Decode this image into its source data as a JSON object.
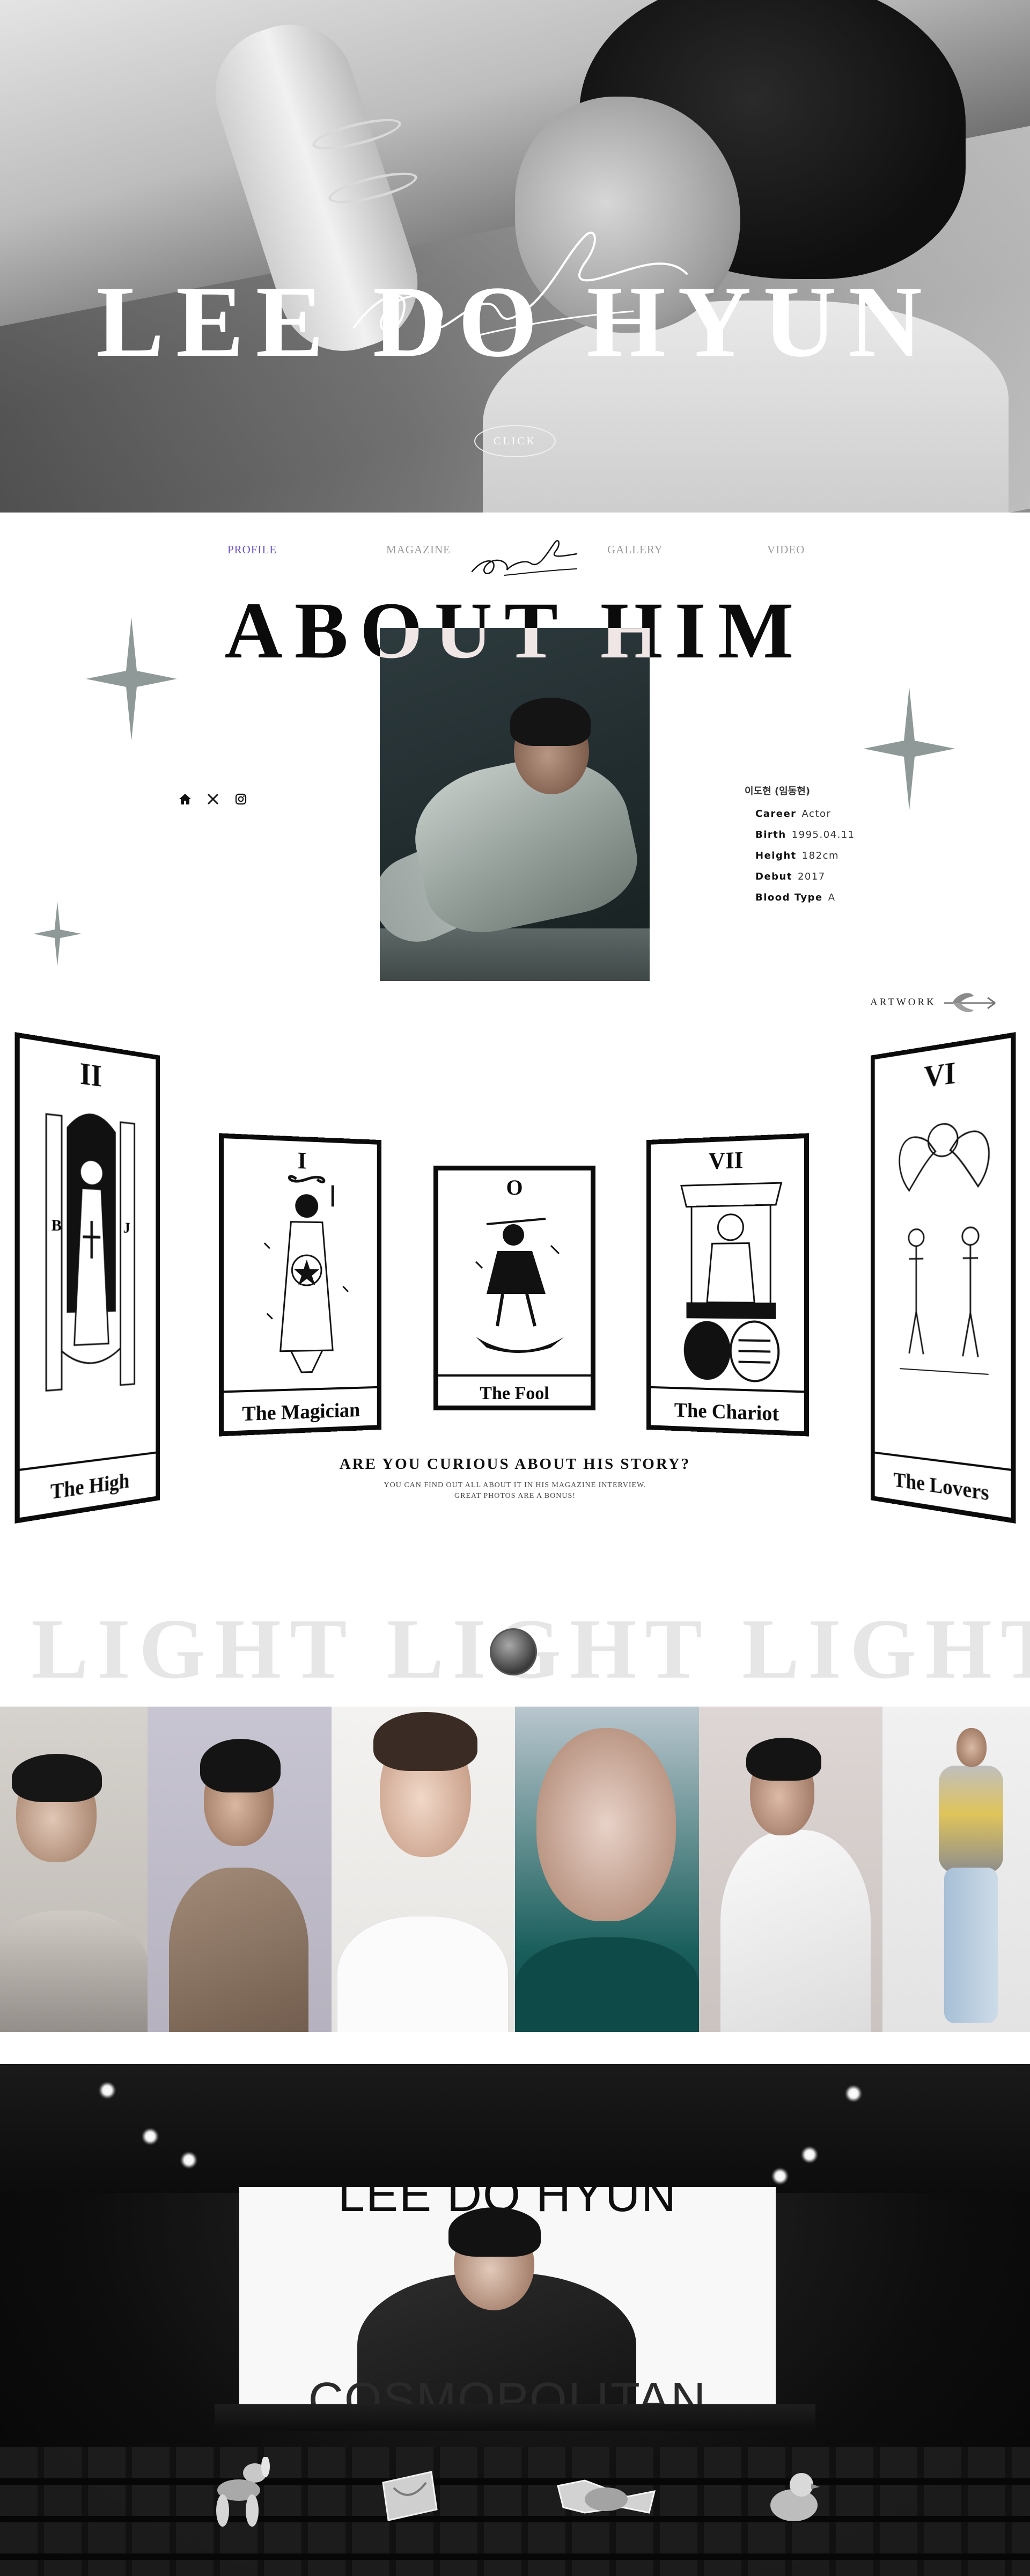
{
  "hero": {
    "title": "LEE DO HYUN",
    "button_label": "CLICK"
  },
  "nav": {
    "items": [
      {
        "label": "PROFILE",
        "active": true
      },
      {
        "label": "MAGAZINE",
        "active": false
      },
      {
        "label": "GALLERY",
        "active": false
      },
      {
        "label": "VIDEO",
        "active": false
      }
    ],
    "active_color": "#6a4fc8"
  },
  "about": {
    "title": "ABOUT HIM",
    "social_icons": [
      "home-icon",
      "x-icon",
      "instagram-icon"
    ],
    "profile": {
      "name": "이도현 (임동현)",
      "rows": [
        {
          "key": "Career",
          "value": "Actor"
        },
        {
          "key": "Birth",
          "value": "1995.04.11"
        },
        {
          "key": "Height",
          "value": "182cm"
        },
        {
          "key": "Debut",
          "value": "2017"
        },
        {
          "key": "Blood Type",
          "value": "A"
        }
      ]
    },
    "artwork_label": "ARTWORK"
  },
  "tarot": {
    "cards": [
      {
        "number": "II",
        "caption": "The High Priestess"
      },
      {
        "number": "I",
        "caption": "The Magician"
      },
      {
        "number": "O",
        "caption": "The Fool"
      },
      {
        "number": "VII",
        "caption": "The Chariot"
      },
      {
        "number": "VI",
        "caption": "The Lovers"
      }
    ],
    "story_title": "ARE YOU CURIOUS ABOUT HIS STORY?",
    "story_lines": [
      "YOU CAN FIND OUT ALL ABOUT IT IN HIS MAGAZINE INTERVIEW.",
      "GREAT PHOTOS ARE A BONUS!"
    ]
  },
  "light": {
    "word": "LIGHT"
  },
  "cinema": {
    "screen_top": "LEE DO HYUN",
    "screen_bottom": "COSMOPOLITAN"
  }
}
